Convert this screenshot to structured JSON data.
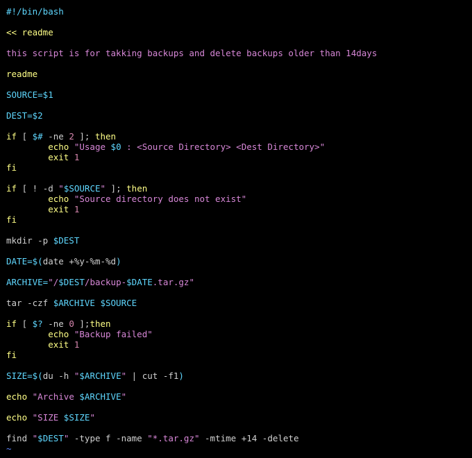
{
  "editor": {
    "colors": {
      "background": "#000000",
      "default": "#d0d0d0",
      "cyan": "#5fd7ff",
      "yellow": "#ffff87",
      "purple": "#d787d7",
      "magenta": "#d787af",
      "blue": "#5f87ff"
    },
    "lines": [
      [
        {
          "t": "#!/bin/bash",
          "c": "cyan"
        }
      ],
      [],
      [
        {
          "t": "<< readme",
          "c": "yellow"
        }
      ],
      [],
      [
        {
          "t": "this script is for takking backups and delete backups older than 14days",
          "c": "purple"
        }
      ],
      [],
      [
        {
          "t": "readme",
          "c": "yellow"
        }
      ],
      [],
      [
        {
          "t": "SOURCE=$1",
          "c": "cyan"
        }
      ],
      [],
      [
        {
          "t": "DEST=$2",
          "c": "cyan"
        }
      ],
      [],
      [
        {
          "t": "if",
          "c": "yellow"
        },
        {
          "t": " [ ",
          "c": "default"
        },
        {
          "t": "$#",
          "c": "cyan"
        },
        {
          "t": " -ne ",
          "c": "default"
        },
        {
          "t": "2",
          "c": "magenta"
        },
        {
          "t": " ]; ",
          "c": "default"
        },
        {
          "t": "then",
          "c": "yellow"
        }
      ],
      [
        {
          "t": "        ",
          "c": "default"
        },
        {
          "t": "echo",
          "c": "yellow"
        },
        {
          "t": " ",
          "c": "default"
        },
        {
          "t": "\"Usage ",
          "c": "purple"
        },
        {
          "t": "$0",
          "c": "cyan"
        },
        {
          "t": " : <Source Directory> <Dest Directory>\"",
          "c": "purple"
        }
      ],
      [
        {
          "t": "        ",
          "c": "default"
        },
        {
          "t": "exit",
          "c": "yellow"
        },
        {
          "t": " ",
          "c": "default"
        },
        {
          "t": "1",
          "c": "magenta"
        }
      ],
      [
        {
          "t": "fi",
          "c": "yellow"
        }
      ],
      [],
      [
        {
          "t": "if",
          "c": "yellow"
        },
        {
          "t": " [ ! -d ",
          "c": "default"
        },
        {
          "t": "\"",
          "c": "purple"
        },
        {
          "t": "$SOURCE",
          "c": "cyan"
        },
        {
          "t": "\"",
          "c": "purple"
        },
        {
          "t": " ]; ",
          "c": "default"
        },
        {
          "t": "then",
          "c": "yellow"
        }
      ],
      [
        {
          "t": "        ",
          "c": "default"
        },
        {
          "t": "echo",
          "c": "yellow"
        },
        {
          "t": " ",
          "c": "default"
        },
        {
          "t": "\"Source directory does not exist\"",
          "c": "purple"
        }
      ],
      [
        {
          "t": "        ",
          "c": "default"
        },
        {
          "t": "exit",
          "c": "yellow"
        },
        {
          "t": " ",
          "c": "default"
        },
        {
          "t": "1",
          "c": "magenta"
        }
      ],
      [
        {
          "t": "fi",
          "c": "yellow"
        }
      ],
      [],
      [
        {
          "t": "mkdir -p ",
          "c": "default"
        },
        {
          "t": "$DEST",
          "c": "cyan"
        }
      ],
      [],
      [
        {
          "t": "DATE=",
          "c": "cyan"
        },
        {
          "t": "$(",
          "c": "cyan"
        },
        {
          "t": "date +%y-%m-%d",
          "c": "default"
        },
        {
          "t": ")",
          "c": "cyan"
        }
      ],
      [],
      [
        {
          "t": "ARCHIVE=",
          "c": "cyan"
        },
        {
          "t": "\"/",
          "c": "purple"
        },
        {
          "t": "$DEST",
          "c": "cyan"
        },
        {
          "t": "/backup-",
          "c": "purple"
        },
        {
          "t": "$DATE",
          "c": "cyan"
        },
        {
          "t": ".tar.gz\"",
          "c": "purple"
        }
      ],
      [],
      [
        {
          "t": "tar -czf ",
          "c": "default"
        },
        {
          "t": "$ARCHIVE",
          "c": "cyan"
        },
        {
          "t": " ",
          "c": "default"
        },
        {
          "t": "$SOURCE",
          "c": "cyan"
        }
      ],
      [],
      [
        {
          "t": "if",
          "c": "yellow"
        },
        {
          "t": " [ ",
          "c": "default"
        },
        {
          "t": "$?",
          "c": "cyan"
        },
        {
          "t": " -ne ",
          "c": "default"
        },
        {
          "t": "0",
          "c": "magenta"
        },
        {
          "t": " ];",
          "c": "default"
        },
        {
          "t": "then",
          "c": "yellow"
        }
      ],
      [
        {
          "t": "        ",
          "c": "default"
        },
        {
          "t": "echo",
          "c": "yellow"
        },
        {
          "t": " ",
          "c": "default"
        },
        {
          "t": "\"Backup failed\"",
          "c": "purple"
        }
      ],
      [
        {
          "t": "        ",
          "c": "default"
        },
        {
          "t": "exit",
          "c": "yellow"
        },
        {
          "t": " ",
          "c": "default"
        },
        {
          "t": "1",
          "c": "magenta"
        }
      ],
      [
        {
          "t": "fi",
          "c": "yellow"
        }
      ],
      [],
      [
        {
          "t": "SIZE=",
          "c": "cyan"
        },
        {
          "t": "$(",
          "c": "cyan"
        },
        {
          "t": "du -h ",
          "c": "default"
        },
        {
          "t": "\"",
          "c": "purple"
        },
        {
          "t": "$ARCHIVE",
          "c": "cyan"
        },
        {
          "t": "\"",
          "c": "purple"
        },
        {
          "t": " | cut -f1",
          "c": "default"
        },
        {
          "t": ")",
          "c": "cyan"
        }
      ],
      [],
      [
        {
          "t": "echo",
          "c": "yellow"
        },
        {
          "t": " ",
          "c": "default"
        },
        {
          "t": "\"Archive ",
          "c": "purple"
        },
        {
          "t": "$ARCHIVE",
          "c": "cyan"
        },
        {
          "t": "\"",
          "c": "purple"
        }
      ],
      [],
      [
        {
          "t": "echo",
          "c": "yellow"
        },
        {
          "t": " ",
          "c": "default"
        },
        {
          "t": "\"SIZE ",
          "c": "purple"
        },
        {
          "t": "$SIZE",
          "c": "cyan"
        },
        {
          "t": "\"",
          "c": "purple"
        }
      ],
      [],
      [
        {
          "t": "find ",
          "c": "default"
        },
        {
          "t": "\"",
          "c": "purple"
        },
        {
          "t": "$DEST",
          "c": "cyan"
        },
        {
          "t": "\"",
          "c": "purple"
        },
        {
          "t": " -type f -name ",
          "c": "default"
        },
        {
          "t": "\"*.tar.gz\"",
          "c": "purple"
        },
        {
          "t": " -mtime +14 -delete",
          "c": "default"
        }
      ],
      [
        {
          "t": "~",
          "c": "blue"
        }
      ]
    ]
  }
}
